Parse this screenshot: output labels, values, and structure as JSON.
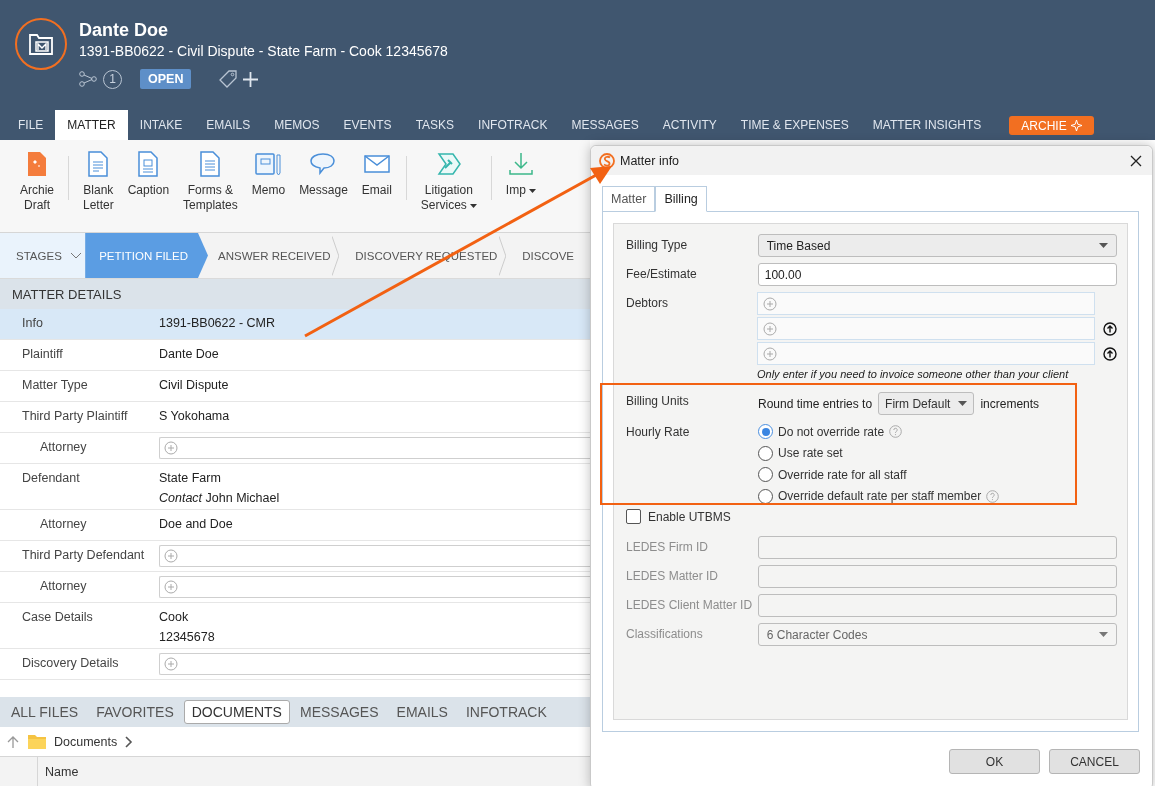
{
  "header": {
    "name": "Dante Doe",
    "subtitle": "1391-BB0622 - Civil Dispute - State Farm - Cook 12345678",
    "count": "1",
    "status": "OPEN"
  },
  "tabs": [
    {
      "label": "FILE",
      "kind": "tab",
      "selected": false
    },
    {
      "label": "MATTER",
      "kind": "tab",
      "selected": true
    },
    {
      "label": "INTAKE",
      "kind": "tab",
      "selected": false
    },
    {
      "label": "EMAILS",
      "kind": "tab",
      "selected": false
    },
    {
      "label": "MEMOS",
      "kind": "tab",
      "selected": false
    },
    {
      "label": "EVENTS",
      "kind": "tab",
      "selected": false
    },
    {
      "label": "TASKS",
      "kind": "tab",
      "selected": false
    },
    {
      "label": "INFOTRACK",
      "kind": "tab",
      "selected": false
    },
    {
      "label": "MESSAGES",
      "kind": "tab",
      "selected": false
    },
    {
      "label": "ACTIVITY",
      "kind": "tab",
      "selected": false
    },
    {
      "label": "TIME & EXPENSES",
      "kind": "tab",
      "selected": false
    },
    {
      "label": "MATTER INSIGHTS",
      "kind": "tab",
      "selected": false
    },
    {
      "label": "ARCHIE",
      "kind": "accent",
      "selected": false
    }
  ],
  "ribbon": [
    {
      "label": "Archie\nDraft",
      "dropdown": false
    },
    {
      "label": "Blank\nLetter",
      "dropdown": false
    },
    {
      "label": "Caption",
      "dropdown": false
    },
    {
      "label": "Forms &\nTemplates",
      "dropdown": false
    },
    {
      "label": "Memo",
      "dropdown": false
    },
    {
      "label": "Message",
      "dropdown": false
    },
    {
      "label": "Email",
      "dropdown": false
    },
    {
      "label": "Litigation\nServices",
      "dropdown": true
    },
    {
      "label": "Imp",
      "dropdown": true
    }
  ],
  "stages": {
    "label": "STAGES",
    "items": [
      {
        "label": "PETITION FILED",
        "selected": true
      },
      {
        "label": "ANSWER RECEIVED",
        "selected": false
      },
      {
        "label": "DISCOVERY REQUESTED",
        "selected": false
      },
      {
        "label": "DISCOVE",
        "selected": false
      }
    ]
  },
  "details": {
    "title": "MATTER DETAILS",
    "rows": [
      {
        "label": "Info",
        "kind": "text",
        "value": "1391-BB0622 - CMR",
        "selected": true
      },
      {
        "label": "Plaintiff",
        "kind": "text",
        "value": "Dante Doe",
        "selected": false
      },
      {
        "label": "Matter Type",
        "kind": "text",
        "value": "Civil Dispute",
        "selected": false
      },
      {
        "label": "Third Party Plaintiff",
        "kind": "text",
        "value": "S Yokohama",
        "selected": false,
        "children": [
          {
            "label": "Attorney",
            "kind": "field",
            "selected": false
          }
        ]
      },
      {
        "label": "Defendant",
        "kind": "lines",
        "lines": [
          "State Farm",
          "*Contact* John Michael"
        ],
        "selected": false,
        "children": [
          {
            "label": "Attorney",
            "kind": "text",
            "value": "Doe and Doe",
            "selected": false
          }
        ]
      },
      {
        "label": "Third Party Defendant",
        "kind": "field",
        "selected": false,
        "children": [
          {
            "label": "Attorney",
            "kind": "field",
            "selected": false
          }
        ]
      },
      {
        "label": "Case Details",
        "kind": "lines",
        "lines": [
          "Cook",
          "12345678"
        ],
        "selected": false
      },
      {
        "label": "Discovery Details",
        "kind": "field",
        "selected": false
      }
    ]
  },
  "file_tabs": [
    {
      "label": "ALL FILES",
      "selected": false
    },
    {
      "label": "FAVORITES",
      "selected": false
    },
    {
      "label": "DOCUMENTS",
      "selected": true
    },
    {
      "label": "MESSAGES",
      "selected": false
    },
    {
      "label": "EMAILS",
      "selected": false
    },
    {
      "label": "INFOTRACK",
      "selected": false
    }
  ],
  "breadcrumb": "Documents",
  "file_columns": [
    "Name"
  ],
  "dialog": {
    "title": "Matter info",
    "tabs": [
      {
        "label": "Matter",
        "selected": false
      },
      {
        "label": "Billing",
        "selected": true
      }
    ],
    "billing_type": {
      "label": "Billing Type",
      "value": "Time Based"
    },
    "fee": {
      "label": "Fee/Estimate",
      "value": "100.00"
    },
    "debtors": {
      "label": "Debtors",
      "fields": [
        {
          "movable": false
        },
        {
          "movable": true
        },
        {
          "movable": true
        }
      ],
      "hint": "Only enter if you need to invoice someone other than your client"
    },
    "billing_units": {
      "label": "Billing Units",
      "before": "Round time entries to",
      "value": "Firm Default",
      "after": "increments"
    },
    "hourly_rate": {
      "label": "Hourly Rate",
      "options": [
        {
          "label": "Do not override rate",
          "help": true,
          "selected": true
        },
        {
          "label": "Use rate set",
          "help": false,
          "selected": false
        },
        {
          "label": "Override rate for all staff",
          "help": false,
          "selected": false
        },
        {
          "label": "Override default rate per staff member",
          "help": true,
          "selected": false
        }
      ]
    },
    "utbms": {
      "label": "Enable UTBMS",
      "checked": false
    },
    "ledes": [
      {
        "label": "LEDES Firm ID",
        "kind": "input",
        "disabled": true
      },
      {
        "label": "LEDES Matter ID",
        "kind": "input",
        "disabled": true
      },
      {
        "label": "LEDES Client Matter ID",
        "kind": "input",
        "disabled": true
      },
      {
        "label": "Classifications",
        "kind": "select",
        "value": "6 Character Codes",
        "disabled": true
      }
    ],
    "buttons": [
      "OK",
      "CANCEL"
    ]
  }
}
